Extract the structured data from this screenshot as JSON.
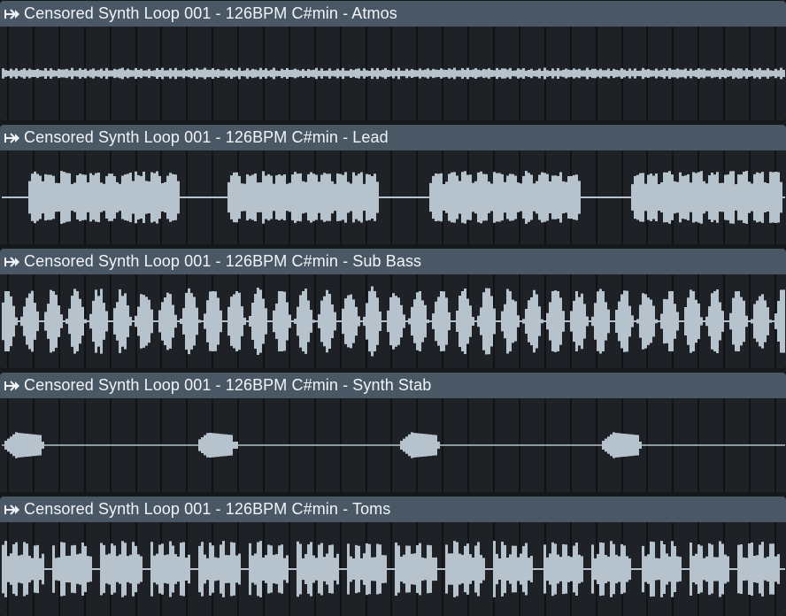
{
  "tracks": [
    {
      "title": "Censored Synth Loop 001 - 126BPM C#min - Atmos",
      "icon": "audio-loop-icon"
    },
    {
      "title": "Censored Synth Loop 001 - 126BPM C#min - Lead",
      "icon": "audio-loop-icon"
    },
    {
      "title": "Censored Synth Loop 001 - 126BPM C#min - Sub Bass",
      "icon": "audio-loop-icon"
    },
    {
      "title": "Censored Synth Loop 001 - 126BPM C#min - Synth Stab",
      "icon": "audio-loop-icon"
    },
    {
      "title": "Censored Synth Loop 001 - 126BPM C#min - Toms",
      "icon": "audio-loop-icon"
    }
  ],
  "colors": {
    "header": "#4a5866",
    "body": "#1e2226",
    "grid": "#111417",
    "waveform": "#b6c2cc",
    "title_text": "#f1f4f7"
  }
}
